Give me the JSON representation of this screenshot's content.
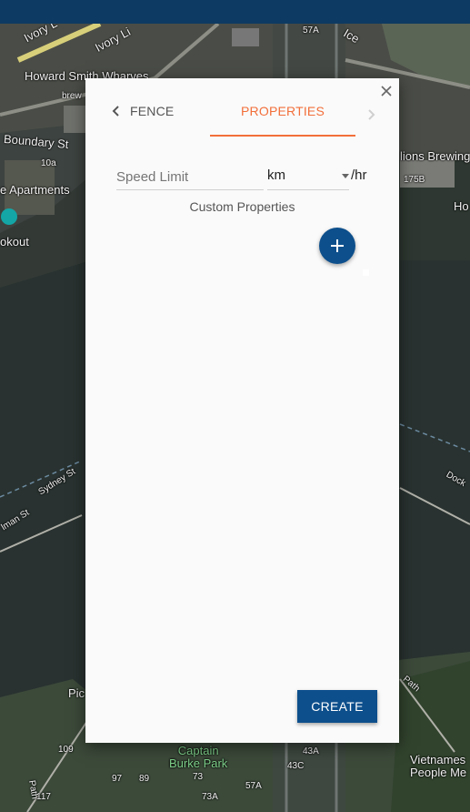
{
  "map": {
    "labels": {
      "ivory_lane_1": "Ivory L",
      "ivory_lane_2": "Ivory Li",
      "ivory_lane_3": "Ice",
      "howard_smith": "Howard Smith Wharves",
      "brew": "brew",
      "boundary": "Boundary St",
      "num_10a": "10a",
      "apartments": "e Apartments",
      "lookout": "okout",
      "lions": "lions Brewing",
      "num_175b": "175B",
      "ho": "Ho",
      "sydney": "Sydney St",
      "lman": "lman St",
      "dock": "Dock",
      "path1": "Path",
      "pic": "Pic",
      "captain": "Captain\nBurke Park",
      "vietnamese": "Vietnames\nPeople Me",
      "n109": "109",
      "n117": "117",
      "n97": "97",
      "n89": "89",
      "n73": "73",
      "n73a": "73A",
      "n57a": "57A",
      "n43a": "43A",
      "n43c": "43C",
      "path2": "Path",
      "n57a_top": "57A"
    }
  },
  "dialog": {
    "tabs": {
      "fence": "FENCE",
      "properties": "PROPERTIES"
    },
    "speed_limit_placeholder": "Speed Limit",
    "unit_value": "km",
    "unit_suffix": "/hr",
    "custom_properties_title": "Custom Properties",
    "create_label": "CREATE"
  },
  "colors": {
    "accent": "#f26f3a",
    "primary": "#0d4f8c",
    "topbar": "#0d3a62"
  }
}
